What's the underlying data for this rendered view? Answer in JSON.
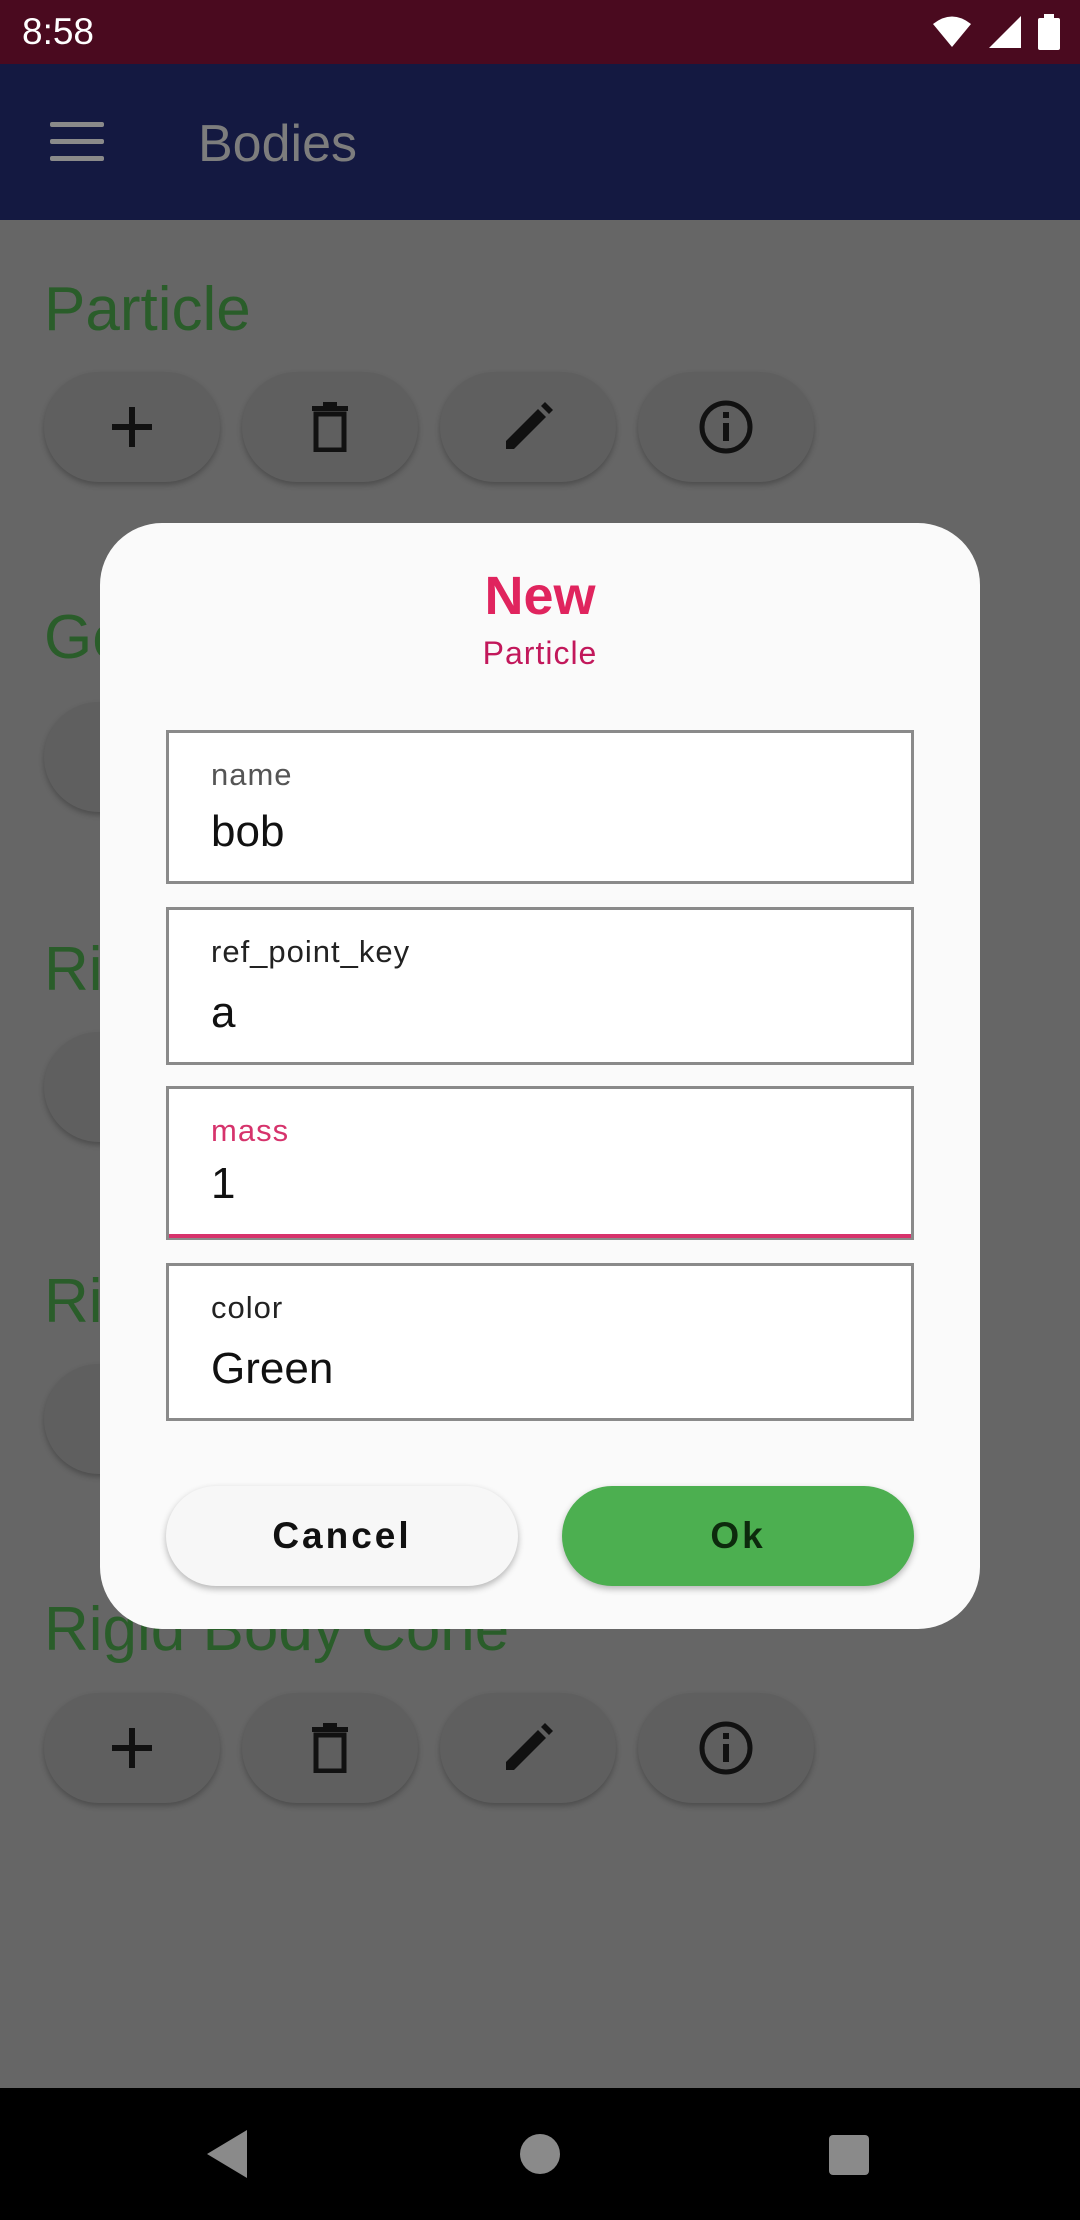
{
  "status_bar": {
    "time": "8:58"
  },
  "app_bar": {
    "title": "Bodies"
  },
  "sections": {
    "particle": "Particle",
    "s2": "Ge",
    "s3": "Ri",
    "s4": "Ri",
    "cone": "Rigid Body Cone"
  },
  "icons": [
    "add-icon",
    "delete-icon",
    "edit-icon",
    "info-icon"
  ],
  "dialog": {
    "title": "New",
    "subtitle": "Particle",
    "fields": [
      {
        "label": "name",
        "value": "bob"
      },
      {
        "label": "ref_point_key",
        "value": "a"
      },
      {
        "label": "mass",
        "value": "1"
      },
      {
        "label": "color",
        "value": "Green"
      }
    ],
    "cancel_label": "Cancel",
    "ok_label": "Ok"
  },
  "colors": {
    "accent": "#e0245e",
    "ok_button": "#4caf50",
    "app_bar": "#141941",
    "status_bar": "#4a0a1f"
  }
}
